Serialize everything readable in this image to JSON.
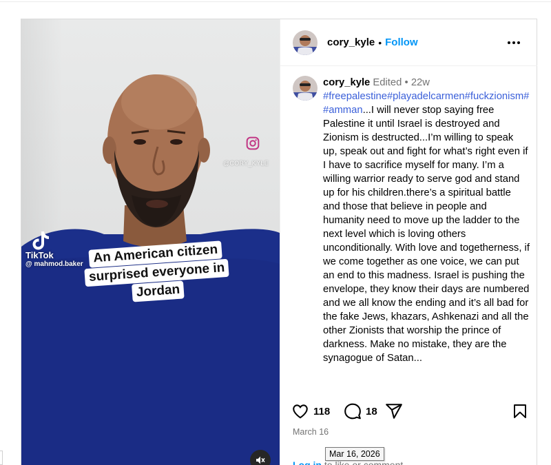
{
  "post": {
    "username": "cory_kyle",
    "follow_label": "Follow",
    "separator": "•",
    "edited_label": "Edited",
    "age": "22w",
    "hashtags": "#freepalestine#playadelcarmen#fuckzionism##amman",
    "caption_text": "...I will never stop saying free Palestine it until Israel is destroyed and Zionism is destructed...I’m willing to speak up, speak out and fight for what’s right even if I have to sacrifice myself for many. I’m a willing warrior ready to serve god and stand up for his children.there’s a spiritual battle and those that believe in people and humanity need to move up the ladder to the next level which is loving others unconditionally. With love and togetherness, if we come together as one voice, we can put an end to this madness. Israel is pushing the envelope, they know their days are numbered and we all know the ending and it’s all bad for the fake Jews, khazars, Ashkenazi and all the other Zionists that worship the prince of darkness. Make no mistake, they are the synagogue of Satan...",
    "likes": "118",
    "comments": "18",
    "date": "March 16",
    "date_tooltip": "Mar 16, 2026",
    "login_link": "Log in",
    "login_suffix": " to like or comment."
  },
  "video": {
    "caption_lines": [
      "An American citizen",
      "surprised everyone in",
      "Jordan"
    ],
    "tiktok_name": "TikTok",
    "tiktok_handle": "@ mahmod.baker",
    "ig_handle": "@CORY_KYLE"
  },
  "colors": {
    "link_blue": "#0095f6",
    "hashtag_blue": "#3a5fd9",
    "muted_text": "#737373",
    "shirt_navy": "#1b2f8a"
  },
  "icons": {
    "like": "heart-icon",
    "comment": "comment-icon",
    "share": "share-icon",
    "save": "bookmark-icon",
    "more": "more-options-icon",
    "mute": "speaker-muted-icon"
  }
}
